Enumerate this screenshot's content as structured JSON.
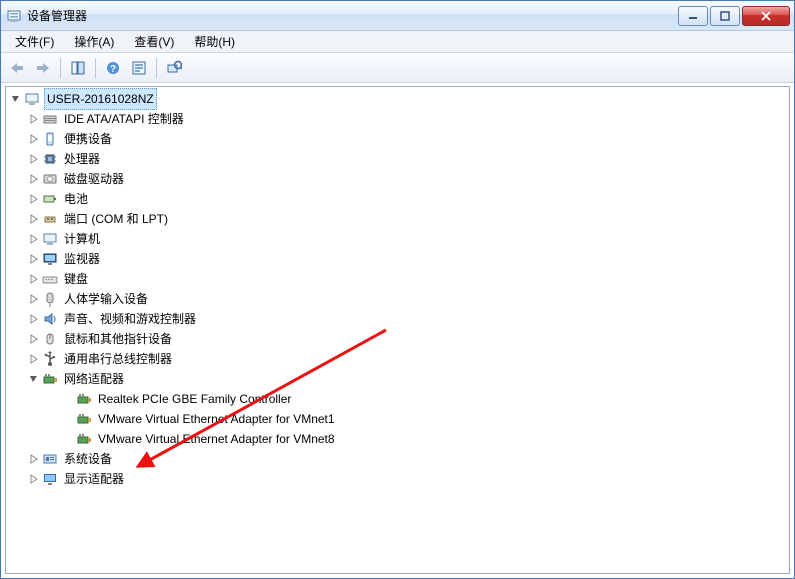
{
  "window": {
    "title": "设备管理器"
  },
  "menu": {
    "file": "文件(F)",
    "action": "操作(A)",
    "view": "查看(V)",
    "help": "帮助(H)"
  },
  "tree": {
    "root": "USER-20161028NZ",
    "nodes": [
      {
        "label": "IDE ATA/ATAPI 控制器",
        "icon": "ide"
      },
      {
        "label": "便携设备",
        "icon": "portable"
      },
      {
        "label": "处理器",
        "icon": "cpu"
      },
      {
        "label": "磁盘驱动器",
        "icon": "disk"
      },
      {
        "label": "电池",
        "icon": "battery"
      },
      {
        "label": "端口 (COM 和 LPT)",
        "icon": "port"
      },
      {
        "label": "计算机",
        "icon": "computer"
      },
      {
        "label": "监视器",
        "icon": "monitor"
      },
      {
        "label": "键盘",
        "icon": "keyboard"
      },
      {
        "label": "人体学输入设备",
        "icon": "hid"
      },
      {
        "label": "声音、视频和游戏控制器",
        "icon": "sound"
      },
      {
        "label": "鼠标和其他指针设备",
        "icon": "mouse"
      },
      {
        "label": "通用串行总线控制器",
        "icon": "usb"
      }
    ],
    "network": {
      "label": "网络适配器",
      "children": [
        "Realtek PCIe GBE Family Controller",
        "VMware Virtual Ethernet Adapter for VMnet1",
        "VMware Virtual Ethernet Adapter for VMnet8"
      ]
    },
    "after": [
      {
        "label": "系统设备",
        "icon": "system"
      },
      {
        "label": "显示适配器",
        "icon": "display"
      }
    ]
  }
}
